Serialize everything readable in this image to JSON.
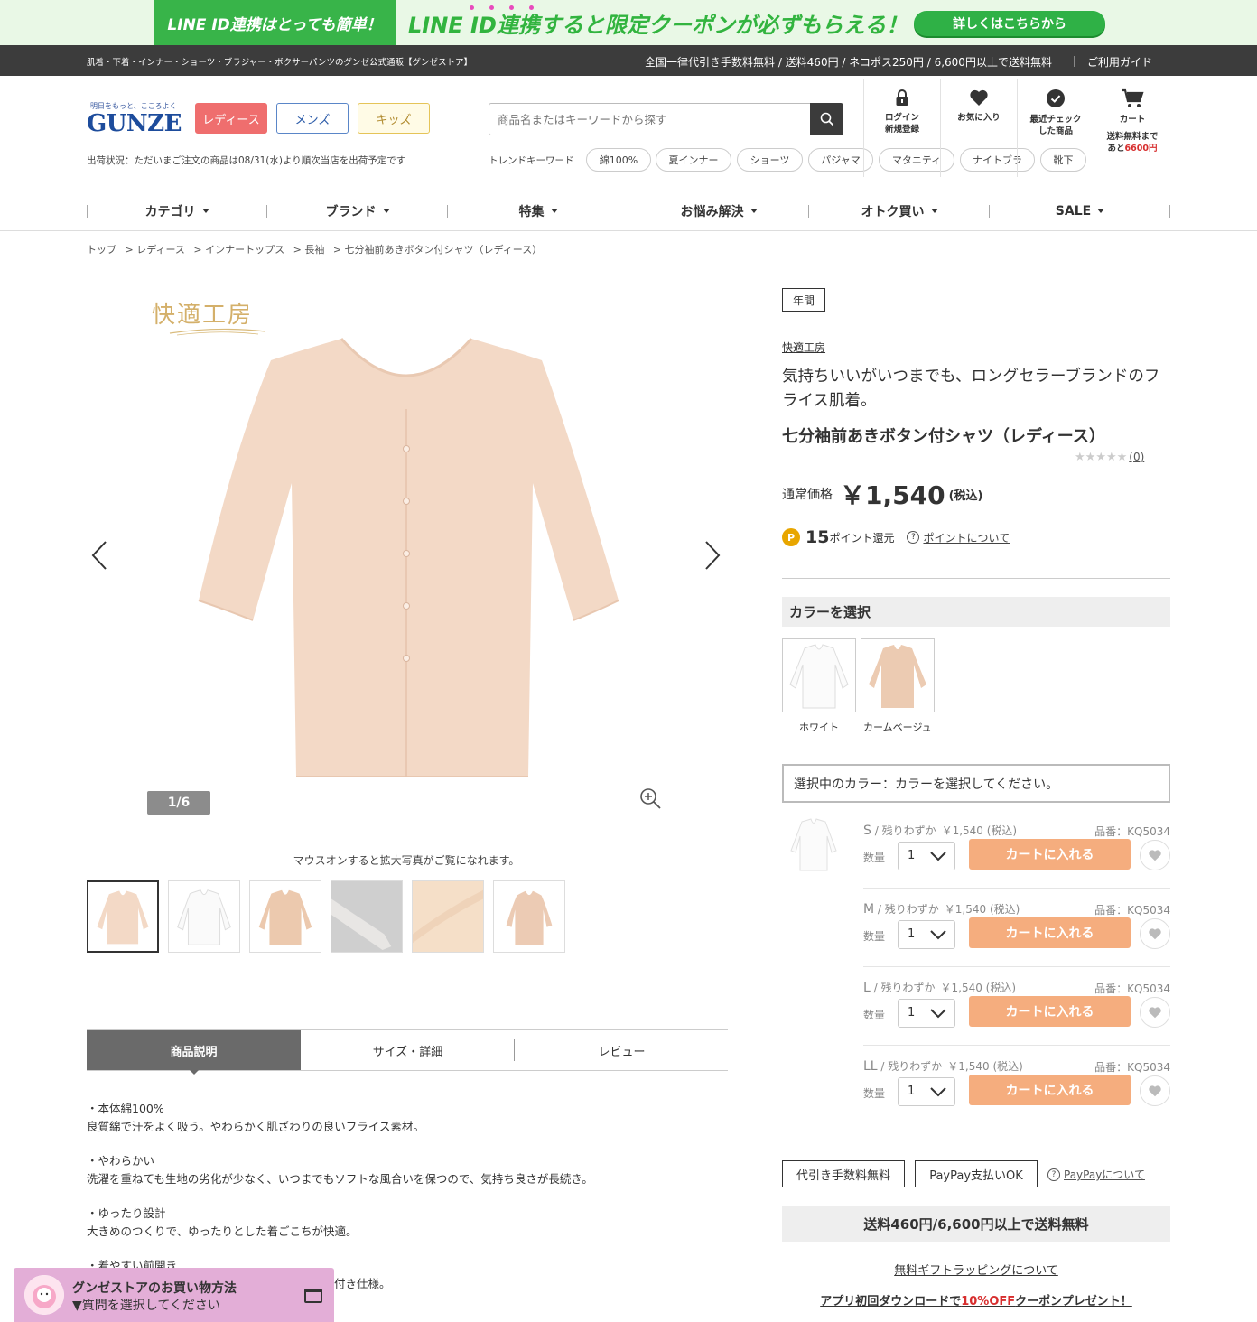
{
  "banner": {
    "left_text": "LINE ID連携はとっても簡単！",
    "main_text": "LINE ID連携すると限定クーポンが必ずもらえる！",
    "button_label": "詳しくはこちらから"
  },
  "topbar": {
    "tagline": "肌着・下着・インナー・ショーツ・ブラジャー・ボクサーパンツのグンゼ公式通販【グンゼストア】",
    "shipping_info": "全国一律代引き手数料無料 / 送料460円 / ネコポス250円 / 6,600円以上で送料無料",
    "guide_link": "ご利用ガイド"
  },
  "header": {
    "logo_tagline": "明日をもっと、こころよく",
    "logo_text": "GUNZE",
    "gender_buttons": [
      "レディース",
      "メンズ",
      "キッズ"
    ],
    "ship_status": "出荷状況：ただいまご注文の商品は08/31(水)より順次当店を出荷予定です",
    "search_placeholder": "商品名またはキーワードから探す",
    "trend_label": "トレンドキーワード",
    "trend_keywords": [
      "綿100%",
      "夏インナー",
      "ショーツ",
      "パジャマ",
      "マタニティ",
      "ナイトブラ",
      "靴下"
    ],
    "icons": {
      "login_line1": "ログイン",
      "login_line2": "新規登録",
      "favorites": "お気に入り",
      "recent_line1": "最近チェック",
      "recent_line2": "した商品",
      "cart": "カート",
      "cart_note_line1": "送料無料まで",
      "cart_note_prefix": "あと",
      "cart_note_amount": "6600円"
    }
  },
  "nav": {
    "items": [
      "カテゴリ",
      "ブランド",
      "特集",
      "お悩み解決",
      "オトク買い",
      "SALE"
    ]
  },
  "breadcrumb": [
    "トップ",
    "> レディース",
    "> インナートップス",
    "> 長袖",
    "> 七分袖前あきボタン付シャツ（レディース）"
  ],
  "gallery": {
    "brand_logo": "快適工房",
    "counter": "1/6",
    "hover_note": "マウスオンすると拡大写真がご覧になれます。",
    "thumbnail_count": 6,
    "selected_index": 0
  },
  "tabs": {
    "labels": [
      "商品説明",
      "サイズ・詳細",
      "レビュー"
    ],
    "active": 0
  },
  "description": [
    {
      "title": "・本体綿100%",
      "text": "良質綿で汗をよく吸う。やわらかく肌ざわりの良いフライス素材。"
    },
    {
      "title": "・やわらかい",
      "text": "洗濯を重ねても生地の劣化が少なく、いつまでもソフトな風合いを保つので、気持ち良さが長続き。"
    },
    {
      "title": "・ゆったり設計",
      "text": "大きめのつくりで、ゆったりとした着ごこちが快適。"
    },
    {
      "title": "・着やすい前開き",
      "text": "付き仕様。"
    }
  ],
  "chat": {
    "title": "グンゼストアのお買い物方法",
    "subtitle": "▼質問を選択してください"
  },
  "product": {
    "badge": "年間",
    "brand": "快適工房",
    "catch": "気持ちいいがいつまでも、ロングセラーブランドのフライス肌着。",
    "name": "七分袖前あきボタン付シャツ（レディース）",
    "rating": 0,
    "review_count": "(0)",
    "price_label": "通常価格",
    "price": "￥1,540",
    "tax": "(税込)",
    "points_coin": "P",
    "points": "15",
    "points_text": "ポイント還元",
    "points_link": "ポイントについて"
  },
  "colors": {
    "heading": "カラーを選択",
    "options": [
      "ホワイト",
      "カームベージュ"
    ],
    "selected_text": "選択中のカラー：カラーを選択してください。"
  },
  "skus": [
    {
      "size": "S",
      "stock": " / 残りわずか",
      "price": "￥1,540 (税込)",
      "code": "品番：KQ5034",
      "qty_label": "数量",
      "qty": "1",
      "button": "カートに入れる"
    },
    {
      "size": "M",
      "stock": " / 残りわずか",
      "price": "￥1,540 (税込)",
      "code": "品番：KQ5034",
      "qty_label": "数量",
      "qty": "1",
      "button": "カートに入れる"
    },
    {
      "size": "L",
      "stock": " / 残りわずか",
      "price": "￥1,540 (税込)",
      "code": "品番：KQ5034",
      "qty_label": "数量",
      "qty": "1",
      "button": "カートに入れる"
    },
    {
      "size": "LL",
      "stock": " / 残りわずか",
      "price": "￥1,540 (税込)",
      "code": "品番：KQ5034",
      "qty_label": "数量",
      "qty": "1",
      "button": "カートに入れる"
    }
  ],
  "payment": {
    "badge_cod": "代引き手数料無料",
    "badge_paypay": "PayPay支払いOK",
    "paypay_link": "PayPayについて",
    "shipping_box": "送料460円/6,600円以上で送料無料",
    "gift_link": "無料ギフトラッピングについて",
    "app_prefix": "アプリ初回ダウンロードで",
    "app_highlight": "10%OFF",
    "app_suffix": "クーポンプレゼント！"
  },
  "colors_theme": {
    "line_green": "#38b449",
    "ladies_red": "#ef6e6e",
    "cart_orange": "#f5ad7e",
    "chat_pink": "#e3aed7",
    "product_beige": "#f3d9c6"
  }
}
